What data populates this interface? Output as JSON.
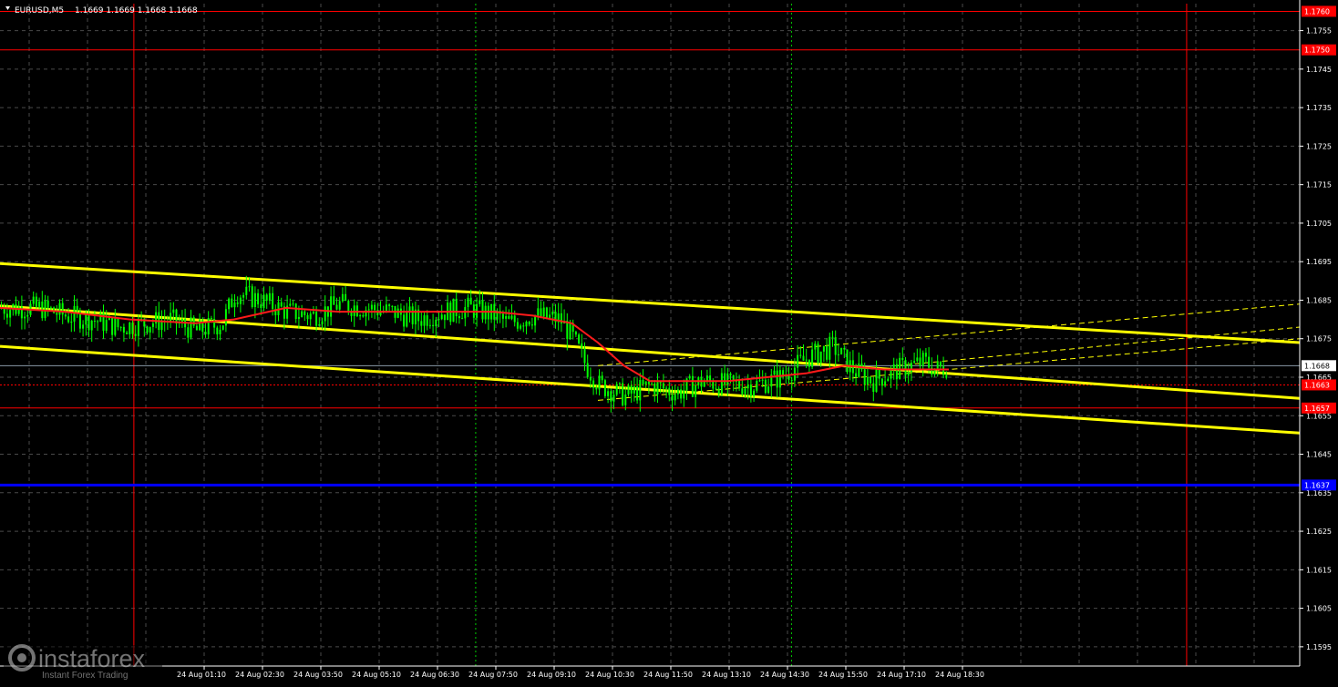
{
  "header": {
    "symbol": "EURUSD,M5",
    "ohlc": "1.1669 1.1669 1.1668 1.1668"
  },
  "colors": {
    "background": "#000000",
    "grid": "#4a4a4a",
    "candle": "#00ff00",
    "ma": "#ff1a1a",
    "channel": "#ffff00",
    "resistance_line": "#ff0000",
    "support_blue": "#0000ff",
    "time_separator": "#ff0000",
    "session_marker": "#00cc00",
    "axis_text": "#ffffff",
    "red_label_bg": "#ff0000",
    "blue_label_bg": "#0000ff"
  },
  "chart_data": {
    "type": "candlestick",
    "title": "EURUSD,M5",
    "ylim": [
      1.159,
      1.1762
    ],
    "y_ticks": [
      "1.1595",
      "1.1605",
      "1.1615",
      "1.1625",
      "1.1635",
      "1.1645",
      "1.1655",
      "1.1665",
      "1.1675",
      "1.1685",
      "1.1695",
      "1.1705",
      "1.1715",
      "1.1725",
      "1.1735",
      "1.1745",
      "1.1755"
    ],
    "x_labels": [
      "24 Aug 01:10",
      "24 Aug 02:30",
      "24 Aug 03:50",
      "24 Aug 05:10",
      "24 Aug 06:30",
      "24 Aug 07:50",
      "24 Aug 09:10",
      "24 Aug 10:30",
      "24 Aug 11:50",
      "24 Aug 13:10",
      "24 Aug 14:30",
      "24 Aug 15:50",
      "24 Aug 17:10",
      "24 Aug 18:30"
    ],
    "current_price": "1.1668",
    "price_levels": [
      {
        "label": "1.1760",
        "value": 1.176,
        "kind": "red-line"
      },
      {
        "label": "1.1750",
        "value": 1.175,
        "kind": "red-line"
      },
      {
        "label": "1.1663",
        "value": 1.1663,
        "kind": "red-dotted"
      },
      {
        "label": "1.1657",
        "value": 1.1657,
        "kind": "red-line"
      },
      {
        "label": "1.1637",
        "value": 1.1637,
        "kind": "blue-line"
      }
    ],
    "close_path": [
      [
        0,
        1.1683
      ],
      [
        0.03,
        1.1683
      ],
      [
        0.05,
        1.1681
      ],
      [
        0.07,
        1.168
      ],
      [
        0.09,
        1.1678
      ],
      [
        0.11,
        1.1679
      ],
      [
        0.13,
        1.168
      ],
      [
        0.15,
        1.1677
      ],
      [
        0.17,
        1.1679
      ],
      [
        0.18,
        1.1687
      ],
      [
        0.2,
        1.1685
      ],
      [
        0.22,
        1.1682
      ],
      [
        0.24,
        1.1681
      ],
      [
        0.26,
        1.1684
      ],
      [
        0.28,
        1.1683
      ],
      [
        0.3,
        1.1682
      ],
      [
        0.32,
        1.168
      ],
      [
        0.34,
        1.1682
      ],
      [
        0.36,
        1.1683
      ],
      [
        0.38,
        1.1681
      ],
      [
        0.39,
        1.1679
      ],
      [
        0.41,
        1.1681
      ],
      [
        0.43,
        1.168
      ],
      [
        0.44,
        1.1675
      ],
      [
        0.45,
        1.1668
      ],
      [
        0.46,
        1.1663
      ],
      [
        0.48,
        1.166
      ],
      [
        0.5,
        1.1663
      ],
      [
        0.52,
        1.1661
      ],
      [
        0.54,
        1.1664
      ],
      [
        0.56,
        1.1663
      ],
      [
        0.58,
        1.1663
      ],
      [
        0.6,
        1.1665
      ],
      [
        0.62,
        1.167
      ],
      [
        0.64,
        1.1673
      ],
      [
        0.655,
        1.1667
      ],
      [
        0.67,
        1.1664
      ],
      [
        0.69,
        1.1667
      ],
      [
        0.71,
        1.1669
      ],
      [
        0.72,
        1.1667
      ],
      [
        0.73,
        1.1668
      ]
    ],
    "ma_path": [
      [
        0,
        1.1683
      ],
      [
        0.05,
        1.1682
      ],
      [
        0.1,
        1.168
      ],
      [
        0.15,
        1.1679
      ],
      [
        0.18,
        1.168
      ],
      [
        0.22,
        1.1683
      ],
      [
        0.26,
        1.1682
      ],
      [
        0.3,
        1.1682
      ],
      [
        0.34,
        1.1682
      ],
      [
        0.38,
        1.1682
      ],
      [
        0.41,
        1.1681
      ],
      [
        0.44,
        1.1679
      ],
      [
        0.46,
        1.1674
      ],
      [
        0.48,
        1.1668
      ],
      [
        0.5,
        1.1664
      ],
      [
        0.53,
        1.1664
      ],
      [
        0.56,
        1.1664
      ],
      [
        0.59,
        1.1665
      ],
      [
        0.62,
        1.1666
      ],
      [
        0.65,
        1.1668
      ],
      [
        0.68,
        1.1667
      ],
      [
        0.71,
        1.1667
      ],
      [
        0.73,
        1.1667
      ]
    ],
    "channel_lines": [
      {
        "from": [
          0,
          1.16945
        ],
        "to": [
          1,
          1.1674
        ]
      },
      {
        "from": [
          0,
          1.16835
        ],
        "to": [
          1,
          1.16595
        ]
      },
      {
        "from": [
          0,
          1.1673
        ],
        "to": [
          1,
          1.16505
        ]
      }
    ],
    "dashed_channel": [
      {
        "from": [
          0.46,
          1.1659
        ],
        "to": [
          1,
          1.1675
        ]
      },
      {
        "from": [
          0.46,
          1.1668
        ],
        "to": [
          1,
          1.1684
        ]
      },
      {
        "from": [
          0.69,
          1.1668
        ],
        "to": [
          1,
          1.1678
        ]
      }
    ],
    "vertical_separators": [
      0.103,
      0.913
    ],
    "session_markers": [
      0.366,
      0.609
    ]
  },
  "watermark": {
    "brand": "instaforex",
    "tagline": "Instant Forex Trading"
  }
}
